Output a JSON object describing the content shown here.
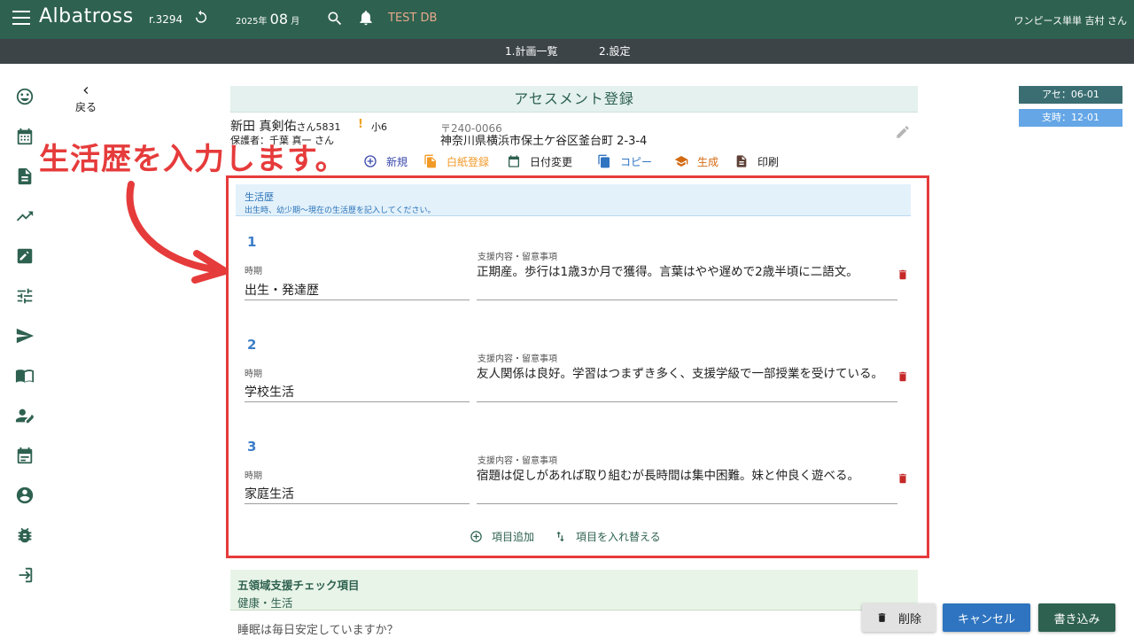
{
  "header": {
    "app_name": "Albatross",
    "version": "r.3294",
    "date_year": "2025年",
    "date_month": "08",
    "date_month_unit": "月",
    "db_name": "TEST DB",
    "user": "ワンピース単単 吉村 さん"
  },
  "subnav": [
    "1.計画一覧",
    "2.設定"
  ],
  "sidebar": {
    "icons": [
      "smiley-icon",
      "calendar-icon",
      "document-icon",
      "trending-up-icon",
      "edit-note-icon",
      "tune-icon",
      "send-icon",
      "book-icon",
      "person-edit-icon",
      "event-icon",
      "account-circle-icon",
      "bug-icon",
      "login-icon"
    ],
    "back_label": "戻る"
  },
  "badges": [
    "アセ：06-01",
    "支時：12-01"
  ],
  "page_title": "アセスメント登録",
  "person": {
    "name": "新田 真剣佑",
    "suffix": "さん5831",
    "warn": "!",
    "grade": "小6",
    "guardian": "保護者：千葉 真一 さん",
    "postal": "〒240-0066",
    "address": "神奈川県横浜市保土ケ谷区釜台町 2-3-4"
  },
  "toolbar": [
    {
      "label": "新規",
      "color": "#3949ab",
      "icon": "add-circle-icon"
    },
    {
      "label": "白紙登録",
      "color": "#f29a27",
      "icon": "copy-filled-icon"
    },
    {
      "label": "日付変更",
      "color": "#2e6150",
      "icon": "calendar-icon"
    },
    {
      "label": "コピー",
      "color": "#2f74c0",
      "icon": "copy-icon"
    },
    {
      "label": "生成",
      "color": "#d46a12",
      "icon": "school-icon"
    },
    {
      "label": "印刷",
      "color": "#5d4037",
      "icon": "print-document-icon"
    }
  ],
  "annotation": "生活歴を入力します。",
  "section": {
    "title": "生活歴",
    "subtitle": "出生時、幼少期〜現在の生活歴を記入してください。",
    "period_label": "時期",
    "detail_label": "支援内容・留意事項",
    "entries": [
      {
        "num": "1",
        "period": "出生・発達歴",
        "detail": "正期産。歩行は1歳3か月で獲得。言葉はやや遅めで2歳半頃に二語文。"
      },
      {
        "num": "2",
        "period": "学校生活",
        "detail": "友人関係は良好。学習はつまずき多く、支援学級で一部授業を受けている。"
      },
      {
        "num": "3",
        "period": "家庭生活",
        "detail": "宿題は促しがあれば取り組むが長時間は集中困難。妹と仲良く遊べる。"
      }
    ],
    "add_label": "項目追加",
    "reorder_label": "項目を入れ替える"
  },
  "next_section": {
    "title": "五領域支援チェック項目",
    "subtitle": "健康・生活",
    "question": "睡眠は毎日安定していますか？"
  },
  "buttons": {
    "delete": "削除",
    "cancel": "キャンセル",
    "save": "書き込み"
  },
  "colors": {
    "header_bg": "#2e6150",
    "subnav_bg": "#3d4448",
    "annotation": "#e63b3b"
  }
}
